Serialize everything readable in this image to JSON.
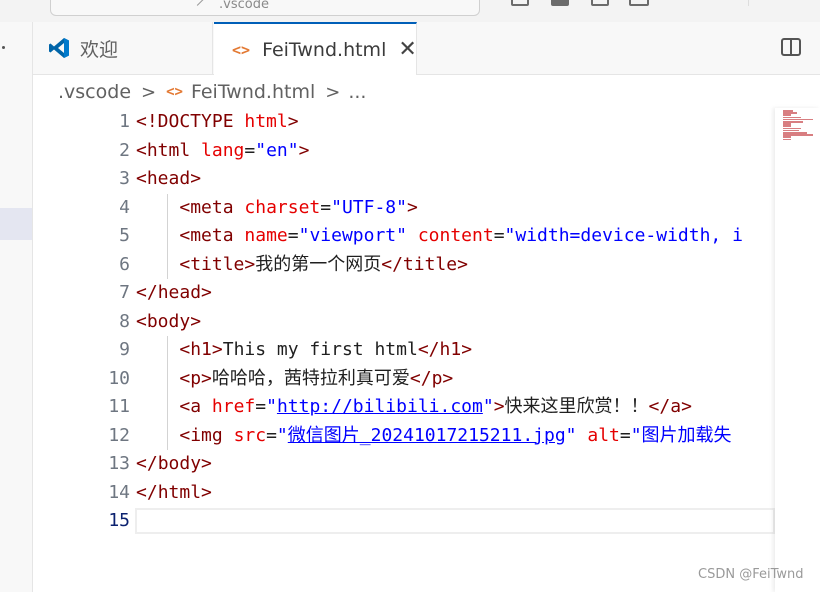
{
  "titlebar": {
    "command_center_text": ".vscode"
  },
  "tabs": {
    "welcome_label": "欢迎",
    "active_label": "FeiTwnd.html",
    "close_symbol": "✕",
    "html_icon": "<>"
  },
  "breadcrumb": {
    "folder": ".vscode",
    "file": "FeiTwnd.html",
    "more": "...",
    "separator": ">"
  },
  "editor": {
    "current_line": 15,
    "lines": [
      {
        "n": "1",
        "html": "<span class='t-punct'>&lt;!DOCTYPE </span><span class='t-attr'>html</span><span class='t-punct'>&gt;</span>"
      },
      {
        "n": "2",
        "html": "<span class='t-punct'>&lt;</span><span class='t-tag'>html</span> <span class='t-attr'>lang</span>=<span class='t-str'>\"en\"</span><span class='t-punct'>&gt;</span>"
      },
      {
        "n": "3",
        "html": "<span class='t-punct'>&lt;</span><span class='t-tag'>head</span><span class='t-punct'>&gt;</span>"
      },
      {
        "n": "4",
        "html": "    <span class='t-punct'>&lt;</span><span class='t-tag'>meta</span> <span class='t-attr'>charset</span>=<span class='t-str'>\"UTF-8\"</span><span class='t-punct'>&gt;</span>"
      },
      {
        "n": "5",
        "html": "    <span class='t-punct'>&lt;</span><span class='t-tag'>meta</span> <span class='t-attr'>name</span>=<span class='t-str'>\"viewport\"</span> <span class='t-attr'>content</span>=<span class='t-str'>\"width=device-width, i</span>"
      },
      {
        "n": "6",
        "html": "    <span class='t-punct'>&lt;</span><span class='t-tag'>title</span><span class='t-punct'>&gt;</span><span class='t-text'>我的第一个网页</span><span class='t-punct'>&lt;/</span><span class='t-tag'>title</span><span class='t-punct'>&gt;</span>"
      },
      {
        "n": "7",
        "html": "<span class='t-punct'>&lt;/</span><span class='t-tag'>head</span><span class='t-punct'>&gt;</span>"
      },
      {
        "n": "8",
        "html": "<span class='t-punct'>&lt;</span><span class='t-tag'>body</span><span class='t-punct'>&gt;</span>"
      },
      {
        "n": "9",
        "html": "    <span class='t-punct'>&lt;</span><span class='t-tag'>h1</span><span class='t-punct'>&gt;</span><span class='t-text'>This my first html</span><span class='t-punct'>&lt;/</span><span class='t-tag'>h1</span><span class='t-punct'>&gt;</span>"
      },
      {
        "n": "10",
        "html": "    <span class='t-punct'>&lt;</span><span class='t-tag'>p</span><span class='t-punct'>&gt;</span><span class='t-text'>哈哈哈，茜特拉利真可爱</span><span class='t-punct'>&lt;/</span><span class='t-tag'>p</span><span class='t-punct'>&gt;</span>"
      },
      {
        "n": "11",
        "html": "    <span class='t-punct'>&lt;</span><span class='t-tag'>a</span> <span class='t-attr'>href</span>=<span class='t-str'>\"</span><span class='t-link'>http://bilibili.com</span><span class='t-str'>\"</span><span class='t-punct'>&gt;</span><span class='t-text'>快来这里欣赏！！</span><span class='t-punct'>&lt;/</span><span class='t-tag'>a</span><span class='t-punct'>&gt;</span>"
      },
      {
        "n": "12",
        "html": "    <span class='t-punct'>&lt;</span><span class='t-tag'>img</span> <span class='t-attr'>src</span>=<span class='t-str'>\"</span><span class='t-link'>微信图片_20241017215211.jpg</span><span class='t-str'>\"</span> <span class='t-attr'>alt</span>=<span class='t-str'>\"图片加载失</span>"
      },
      {
        "n": "13",
        "html": "<span class='t-punct'>&lt;/</span><span class='t-tag'>body</span><span class='t-punct'>&gt;</span>"
      },
      {
        "n": "14",
        "html": "<span class='t-punct'>&lt;/</span><span class='t-tag'>html</span><span class='t-punct'>&gt;</span>"
      },
      {
        "n": "15",
        "html": ""
      }
    ]
  },
  "watermark": "CSDN @FeiTwnd",
  "colors": {
    "accent": "#005fb8",
    "tag": "#800000",
    "attr": "#e50000",
    "string": "#0000ff",
    "html_icon": "#e37933"
  }
}
